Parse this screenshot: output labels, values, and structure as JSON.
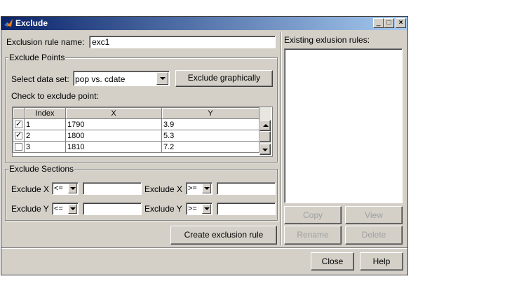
{
  "window": {
    "title": "Exclude",
    "min": "_",
    "max": "□",
    "close": "×"
  },
  "rule_name": {
    "label": "Exclusion rule name:",
    "value": "exc1"
  },
  "points": {
    "title": "Exclude Points",
    "dataset_label": "Select data set:",
    "dataset_value": "pop vs. cdate",
    "graphically_button": "Exclude graphically",
    "check_label": "Check to exclude point:",
    "columns": [
      "Index",
      "X",
      "Y"
    ],
    "rows": [
      {
        "checked": "✓",
        "index": "1",
        "x": "1790",
        "y": "3.9"
      },
      {
        "checked": "✓",
        "index": "2",
        "x": "1800",
        "y": "5.3"
      },
      {
        "checked": "",
        "index": "3",
        "x": "1810",
        "y": "7.2"
      }
    ]
  },
  "sections": {
    "title": "Exclude Sections",
    "x_label": "Exclude X",
    "y_label": "Exclude Y",
    "le": "<=",
    "ge": ">="
  },
  "create_button": "Create exclusion rule",
  "existing_label": "Existing exlusion rules:",
  "buttons": {
    "copy": "Copy",
    "view": "View",
    "rename": "Rename",
    "delete": "Delete",
    "close": "Close",
    "help": "Help"
  }
}
